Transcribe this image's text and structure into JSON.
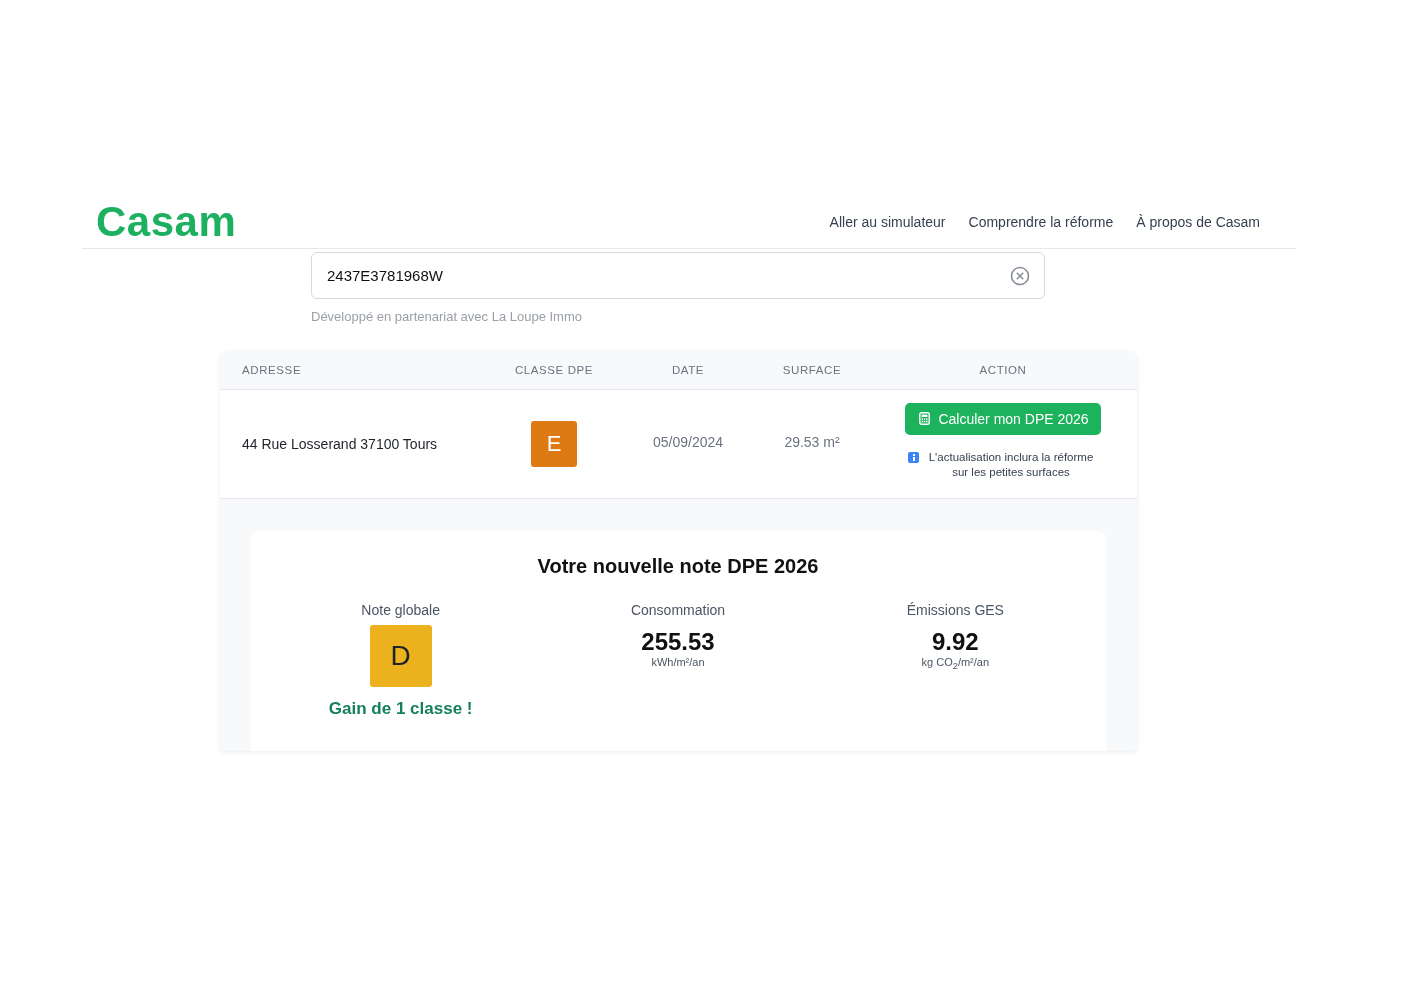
{
  "header": {
    "logo": "Casam",
    "nav": [
      "Aller au simulateur",
      "Comprendre la réforme",
      "À propos de Casam"
    ]
  },
  "search": {
    "value": "2437E3781968W",
    "note": "Développé en partenariat avec La Loupe Immo"
  },
  "table": {
    "columns": [
      "ADRESSE",
      "CLASSE DPE",
      "DATE",
      "SURFACE",
      "ACTION"
    ],
    "rows": [
      {
        "address": "44 Rue Losserand 37100 Tours",
        "grade": "E",
        "color": "#dd7a14",
        "date": "05/09/2024",
        "surface": "29.53 m²",
        "action": "Calculer mon DPE 2026",
        "info": "L'actualisation inclura la réforme sur les petites surfaces"
      }
    ]
  },
  "result": {
    "title": "Votre nouvelle note DPE 2026",
    "metrics": [
      {
        "kind": "grade",
        "label": "Note globale",
        "value": "D",
        "color": "#ebb21d",
        "note": "Gain de 1 classe !"
      },
      {
        "kind": "number",
        "label": "Consommation",
        "value": "255.53",
        "unit": "kWh/m²/an"
      },
      {
        "kind": "number",
        "label": "Émissions GES",
        "value": "9.92",
        "unit": "kg CO$_{2}$/m²/an"
      }
    ]
  }
}
